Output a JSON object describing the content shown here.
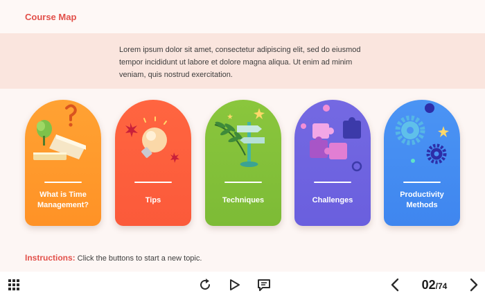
{
  "header": {
    "title": "Course Map"
  },
  "intro": {
    "text": "Lorem ipsum dolor sit amet, consectetur adipiscing elit, sed do eiusmod tempor incididunt ut labore et dolore magna aliqua. Ut enim ad minim veniam, quis nostrud exercitation."
  },
  "topics": [
    {
      "label": "What is Time Management?",
      "color": "#ff9a2e",
      "icon": "books-question-icon"
    },
    {
      "label": "Tips",
      "color": "#fd5f3c",
      "icon": "lightbulb-icon"
    },
    {
      "label": "Techniques",
      "color": "#83c139",
      "icon": "signpost-icon"
    },
    {
      "label": "Challenges",
      "color": "#6f64e0",
      "icon": "puzzle-icon"
    },
    {
      "label": "Productivity Methods",
      "color": "#448cf1",
      "icon": "gears-icon"
    }
  ],
  "instructions": {
    "label": "Instructions:",
    "text": "Click the buttons to start a new topic."
  },
  "toolbar": {
    "menu_icon": "grid-menu-icon",
    "replay_icon": "replay-icon",
    "play_icon": "play-icon",
    "notes_icon": "transcript-icon",
    "prev_icon": "chevron-left-icon",
    "next_icon": "chevron-right-icon"
  },
  "pagination": {
    "current": "02",
    "separator": "/",
    "total": "74"
  }
}
